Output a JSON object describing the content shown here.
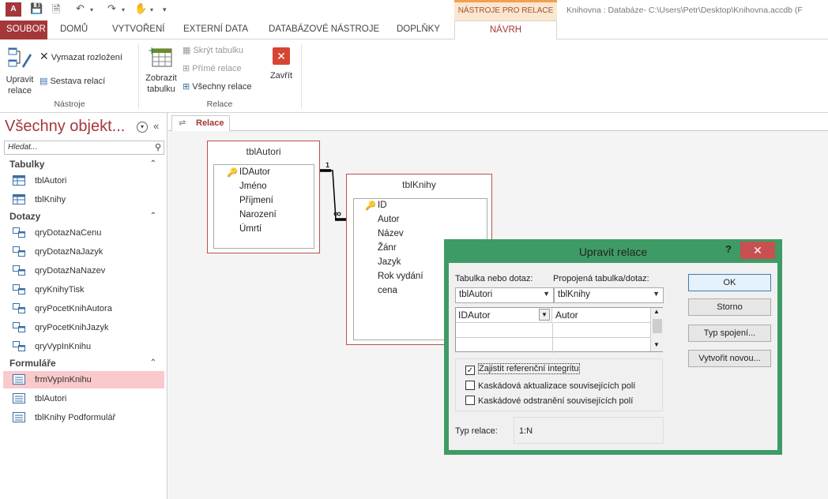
{
  "titlebar": {
    "app_icon": "A",
    "context_tab_header": "NÁSTROJE PRO RELACE",
    "window_title": "Knihovna : Databáze- C:\\Users\\Petr\\Desktop\\Knihovna.accdb (F"
  },
  "tabs": [
    "SOUBOR",
    "DOMŮ",
    "VYTVOŘENÍ",
    "EXTERNÍ DATA",
    "DATABÁZOVÉ NÁSTROJE",
    "DOPLŇKY",
    "NÁVRH"
  ],
  "ribbon": {
    "edit_relations": "Upravit relace",
    "clear_layout": "Vymazat rozložení",
    "relation_report": "Sestava relací",
    "group_tools": "Nástroje",
    "show_table": "Zobrazit tabulku",
    "hide_table": "Skrýt tabulku",
    "direct_relations": "Přímé relace",
    "all_relations": "Všechny relace",
    "close": "Zavřít",
    "group_relations": "Relace"
  },
  "nav": {
    "title": "Všechny objekt...",
    "search_placeholder": "Hledat...",
    "cat_tables": "Tabulky",
    "tables": [
      "tblAutori",
      "tblKnihy"
    ],
    "cat_queries": "Dotazy",
    "queries": [
      "qryDotazNaCenu",
      "qryDotazNaJazyk",
      "qryDotazNaNazev",
      "qryKnihyTisk",
      "qryPocetKnihAutora",
      "qryPocetKnihJazyk",
      "qryVypInKnihu"
    ],
    "cat_forms": "Formuláře",
    "forms": [
      "frmVypInKnihu",
      "tblAutori",
      "tblKnihy Podformulář"
    ]
  },
  "doc_tab": "Relace",
  "tblAutori": {
    "title": "tblAutori",
    "fields": [
      "IDAutor",
      "Jméno",
      "Příjmení",
      "Narození",
      "Úmrtí"
    ]
  },
  "tblKnihy": {
    "title": "tblKnihy",
    "fields": [
      "ID",
      "Autor",
      "Název",
      "Žánr",
      "Jazyk",
      "Rok vydání",
      "cena"
    ]
  },
  "relation": {
    "one": "1",
    "many": "∞"
  },
  "dialog": {
    "title": "Upravit relace",
    "help": "?",
    "close": "✕",
    "label_table": "Tabulka nebo dotaz:",
    "label_related": "Propojená tabulka/dotaz:",
    "table_value": "tblAutori",
    "related_value": "tblKnihy",
    "field_left": "IDAutor",
    "field_right": "Autor",
    "chk_integrity": "Zajistit referenční integritu",
    "chk_cascade_update": "Kaskádová aktualizace souvisejících polí",
    "chk_cascade_delete": "Kaskádové odstranění souvisejících polí",
    "rel_type_label": "Typ relace:",
    "rel_type_value": "1:N",
    "btn_ok": "OK",
    "btn_cancel": "Storno",
    "btn_join": "Typ spojení...",
    "btn_new": "Vytvořit novou..."
  }
}
